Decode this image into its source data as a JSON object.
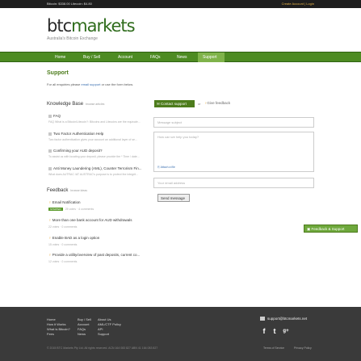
{
  "topbar": {
    "ticker": "Bitcoin: $338.00   Litecoin: $4.80",
    "auth": "Create Account | Login"
  },
  "logo": {
    "brand_prefix": "btc",
    "brand_suffix": "markets",
    "tagline": "Australia's Bitcoin Exchange"
  },
  "nav": {
    "items": [
      "Home",
      "Buy / Sell",
      "Account",
      "FAQs",
      "News",
      "Support"
    ]
  },
  "support": {
    "heading": "Support",
    "intro_prefix": "For all enquiries please",
    "intro_link": "email support",
    "intro_suffix": "or use the form below."
  },
  "knowledge_base": {
    "heading": "Knowledge Base",
    "count": "browse articles",
    "items": [
      {
        "title": "FAQ",
        "desc": "FAQ What is a Bitcoin/Litecoin?: Bitcoins and Litecoins are the equivale..."
      },
      {
        "title": "Two Factor Authentication Help",
        "desc": "Two factor authentication gives your account an additional layer of se..."
      },
      {
        "title": "Confirming your AUD deposit?",
        "desc": "To assist us with locating your deposit, please provide the * Time / date..."
      },
      {
        "title": "Anti Money Laundering (AML), Counter Terrorism Fin...",
        "desc": "What does AUTRAC /AT AUSTRAC's purpose is to protect the integrit..."
      }
    ]
  },
  "feedback": {
    "heading": "Feedback",
    "count": "browse ideas",
    "items": [
      {
        "title": "Email Notification",
        "badge": "STARTED",
        "meta": "25 votes  ·  4 comments"
      },
      {
        "title": "More than one bank account for AUD withdrawals",
        "meta": "22 votes  ·  0 comments"
      },
      {
        "title": "Enable BAD as a login option",
        "meta": "15 votes  ·  0 comments"
      },
      {
        "title": "Provide a utility/overview of past deposits, current co...",
        "meta": "12 votes  ·  0 comments"
      }
    ]
  },
  "contact_form": {
    "contact_button": "Contact support",
    "or": "or",
    "give_feedback": "Give feedback",
    "subject_placeholder": "Message subject",
    "message_placeholder": "How can we help you today?",
    "attach": "Attach a file",
    "email_placeholder": "Your email address",
    "send": "Send message"
  },
  "float_feedback": "Feedback & Support",
  "footer": {
    "col1": [
      "Home",
      "How it Works",
      "What is Bitcoin?",
      "Fees"
    ],
    "col2": [
      "Buy / Sell",
      "Account",
      "FAQs",
      "News"
    ],
    "col3": [
      "About Us",
      "AML/CTF Policy",
      "API",
      "Support"
    ],
    "email": "support@btcmarkets.net",
    "social": [
      "f",
      "t",
      "g+"
    ],
    "copyright": "© 2015 BTC Markets Pty Ltd. All rights reserved. ACN 164 083 827  ABN 41 164 083 827",
    "terms": "Terms of Service",
    "privacy": "Privacy Policy"
  },
  "colors": {
    "nav": "#4d8b22",
    "nav_active": "#7fb34a",
    "heading": "#4d7c1c",
    "footer": "#3a3a3a",
    "accent": "#e8a83a"
  }
}
